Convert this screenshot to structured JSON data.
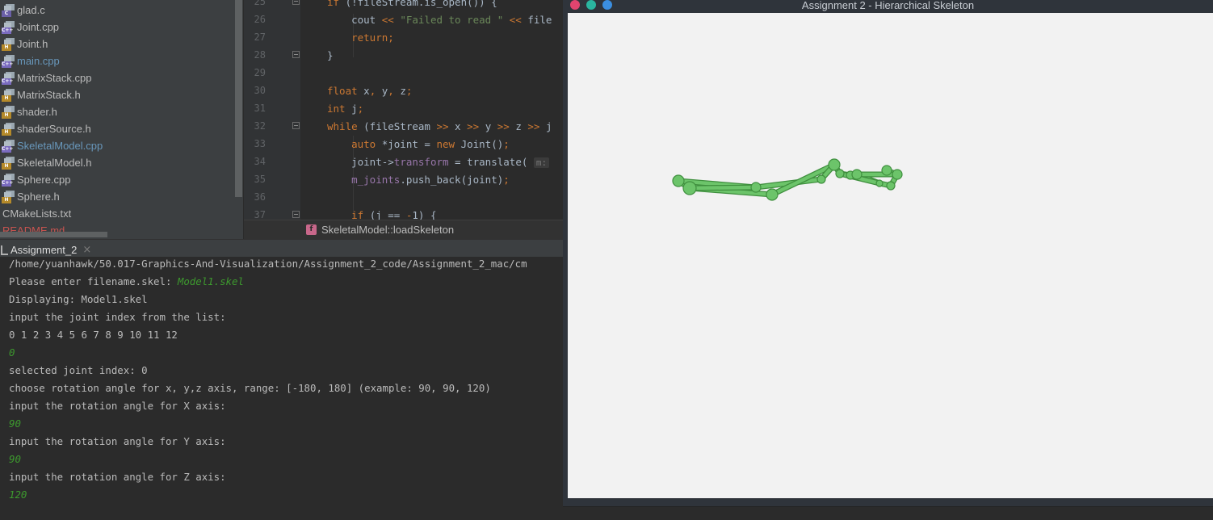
{
  "project_tree": {
    "items": [
      {
        "label": "glad.c",
        "icon": "c-file-icon",
        "badge": "C",
        "state": "normal"
      },
      {
        "label": "Joint.cpp",
        "icon": "cpp-file-icon",
        "badge": "C++",
        "state": "normal"
      },
      {
        "label": "Joint.h",
        "icon": "h-file-icon",
        "badge": "H",
        "state": "normal"
      },
      {
        "label": "main.cpp",
        "icon": "cpp-file-icon",
        "badge": "C++",
        "state": "modified"
      },
      {
        "label": "MatrixStack.cpp",
        "icon": "cpp-file-icon",
        "badge": "C++",
        "state": "normal"
      },
      {
        "label": "MatrixStack.h",
        "icon": "h-file-icon",
        "badge": "H",
        "state": "normal"
      },
      {
        "label": "shader.h",
        "icon": "h-file-icon",
        "badge": "H",
        "state": "normal"
      },
      {
        "label": "shaderSource.h",
        "icon": "h-file-icon",
        "badge": "H",
        "state": "normal"
      },
      {
        "label": "SkeletalModel.cpp",
        "icon": "cpp-file-icon",
        "badge": "C++",
        "state": "modified"
      },
      {
        "label": "SkeletalModel.h",
        "icon": "h-file-icon",
        "badge": "H",
        "state": "normal"
      },
      {
        "label": "Sphere.cpp",
        "icon": "cpp-file-icon",
        "badge": "C++",
        "state": "normal"
      },
      {
        "label": "Sphere.h",
        "icon": "h-file-icon",
        "badge": "H",
        "state": "normal"
      },
      {
        "label": "CMakeLists.txt",
        "icon": "none",
        "badge": "",
        "state": "normal"
      },
      {
        "label": "README.md",
        "icon": "none",
        "badge": "",
        "state": "untracked"
      }
    ]
  },
  "editor": {
    "lines": [
      {
        "num": "25",
        "fold": true,
        "html_key": "l25"
      },
      {
        "num": "26",
        "fold": false,
        "html_key": "l26"
      },
      {
        "num": "27",
        "fold": false,
        "html_key": "l27"
      },
      {
        "num": "28",
        "fold": true,
        "html_key": "l28"
      },
      {
        "num": "29",
        "fold": false,
        "html_key": "l29"
      },
      {
        "num": "30",
        "fold": false,
        "html_key": "l30"
      },
      {
        "num": "31",
        "fold": false,
        "html_key": "l31"
      },
      {
        "num": "32",
        "fold": true,
        "html_key": "l32"
      },
      {
        "num": "33",
        "fold": false,
        "html_key": "l33"
      },
      {
        "num": "34",
        "fold": false,
        "html_key": "l34"
      },
      {
        "num": "35",
        "fold": false,
        "html_key": "l35"
      },
      {
        "num": "36",
        "fold": false,
        "html_key": "l36"
      },
      {
        "num": "37",
        "fold": true,
        "html_key": "l37"
      }
    ],
    "code": {
      "l25": [
        [
          "kw",
          "if "
        ],
        [
          "",
          "(!fileStream.is_open()) {"
        ]
      ],
      "l26": [
        [
          "",
          "    cout "
        ],
        [
          "kw",
          "<< "
        ],
        [
          "str",
          "\"Failed to read \""
        ],
        [
          "kw",
          " << "
        ],
        [
          "",
          "file"
        ]
      ],
      "l27": [
        [
          "kw",
          "    return;"
        ]
      ],
      "l28": [
        [
          "",
          "}"
        ]
      ],
      "l29": [],
      "l30": [
        [
          "kw",
          "float "
        ],
        [
          "",
          "x"
        ],
        [
          "kw",
          ", "
        ],
        [
          "",
          "y"
        ],
        [
          "kw",
          ", "
        ],
        [
          "",
          "z"
        ],
        [
          "kw",
          ";"
        ]
      ],
      "l31": [
        [
          "kw",
          "int "
        ],
        [
          "",
          "j"
        ],
        [
          "kw",
          ";"
        ]
      ],
      "l32": [
        [
          "kw",
          "while "
        ],
        [
          "",
          "(fileStream "
        ],
        [
          "kw",
          ">> "
        ],
        [
          "",
          "x "
        ],
        [
          "kw",
          ">> "
        ],
        [
          "",
          "y "
        ],
        [
          "kw",
          ">> "
        ],
        [
          "",
          "z "
        ],
        [
          "kw",
          ">> "
        ],
        [
          "",
          "j"
        ]
      ],
      "l33": [
        [
          "kw",
          "    auto "
        ],
        [
          "",
          "*joint = "
        ],
        [
          "kw",
          "new "
        ],
        [
          "",
          "Joint()"
        ],
        [
          "kw",
          ";"
        ]
      ],
      "l34": [
        [
          "",
          "    joint->"
        ],
        [
          "fld",
          "transform"
        ],
        [
          "",
          " = translate( "
        ],
        [
          "hint",
          "m:"
        ]
      ],
      "l35": [
        [
          "fld",
          "    m_joints"
        ],
        [
          "",
          ".push_back(joint)"
        ],
        [
          "kw",
          ";"
        ]
      ],
      "l36": [],
      "l37": [
        [
          "kw",
          "    if "
        ],
        [
          "",
          "(j == "
        ],
        [
          "kw",
          "-"
        ],
        [
          "",
          "1) {"
        ]
      ]
    },
    "breadcrumb": {
      "icon_letter": "f",
      "text": "SkeletalModel::loadSkeleton"
    }
  },
  "run_panel": {
    "tab_label": "Assignment_2",
    "tab_close": "×",
    "lines": [
      {
        "segments": [
          {
            "t": "/home/yuanhawk/50.017-Graphics-And-Visualization/Assignment_2_code/Assignment_2_mac/cm",
            "input": false
          }
        ]
      },
      {
        "segments": [
          {
            "t": "Please enter filename.skel: ",
            "input": false
          },
          {
            "t": "Model1.skel",
            "input": true
          }
        ]
      },
      {
        "segments": [
          {
            "t": "Displaying: Model1.skel",
            "input": false
          }
        ]
      },
      {
        "segments": [
          {
            "t": "input the joint index from the list:",
            "input": false
          }
        ]
      },
      {
        "segments": [
          {
            "t": "0 1 2 3 4 5 6 7 8 9 10 11 12",
            "input": false
          }
        ]
      },
      {
        "segments": [
          {
            "t": "0",
            "input": true
          }
        ]
      },
      {
        "segments": [
          {
            "t": "selected joint index: 0",
            "input": false
          }
        ]
      },
      {
        "segments": [
          {
            "t": "choose rotation angle for x, y,z axis, range: [-180, 180] (example: 90, 90, 120)",
            "input": false
          }
        ]
      },
      {
        "segments": [
          {
            "t": "input the rotation angle for X axis:",
            "input": false
          }
        ]
      },
      {
        "segments": [
          {
            "t": "90",
            "input": true
          }
        ]
      },
      {
        "segments": [
          {
            "t": "input the rotation angle for Y axis:",
            "input": false
          }
        ]
      },
      {
        "segments": [
          {
            "t": "90",
            "input": true
          }
        ]
      },
      {
        "segments": [
          {
            "t": "input the rotation angle for Z axis:",
            "input": false
          }
        ]
      },
      {
        "segments": [
          {
            "t": "120",
            "input": true
          }
        ]
      }
    ]
  },
  "app_window": {
    "title": "Assignment 2 - Hierarchical Skeleton",
    "controls": [
      "close",
      "minimize",
      "maximize"
    ],
    "skeleton_color": "#6cc46a",
    "skeleton_outline": "#3f8f3e",
    "background": "#f2f2f2"
  }
}
